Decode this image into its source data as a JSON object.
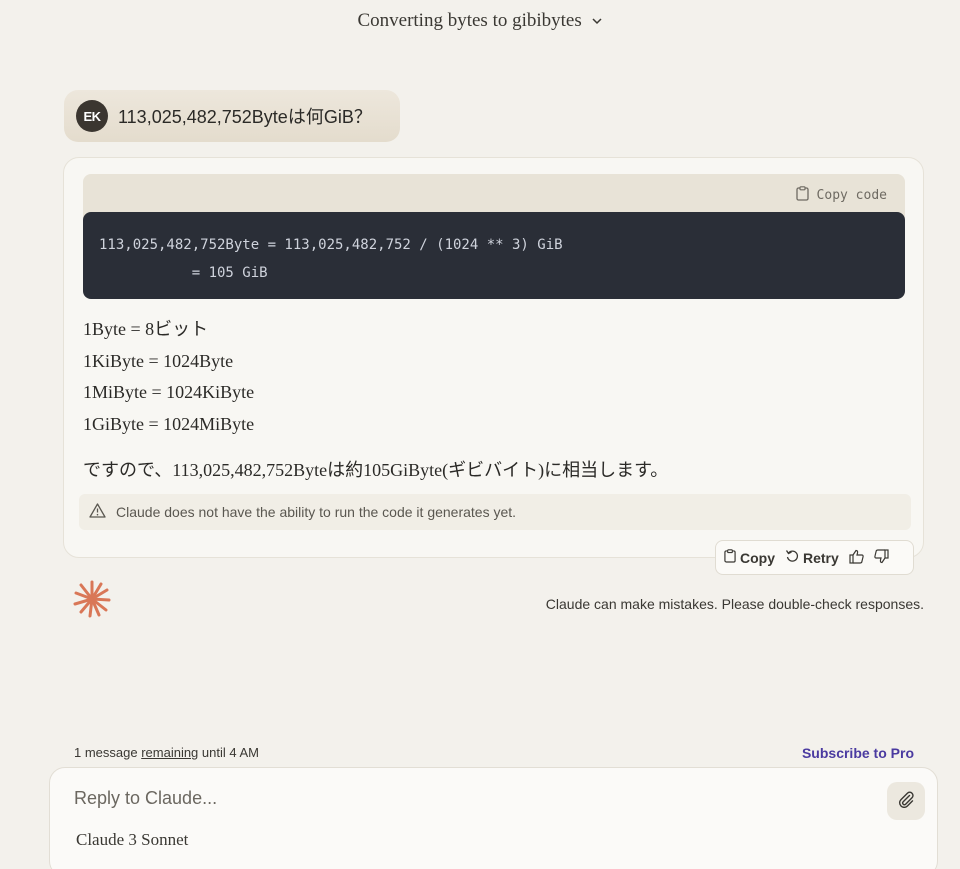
{
  "header": {
    "title": "Converting bytes to gibibytes",
    "chevron_icon": "chevron-down-icon"
  },
  "user_message": {
    "avatar_initials": "EK",
    "text": "113,025,482,752Byteは何GiB？"
  },
  "assistant": {
    "copy_code_label": "Copy code",
    "code_lines": [
      "113,025,482,752Byte = 113,025,482,752 / (1024 ** 3) GiB",
      "           = 105 GiB"
    ],
    "definitions": [
      "1Byte = 8ビット",
      "1KiByte = 1024Byte",
      "1MiByte = 1024KiByte",
      "1GiByte = 1024MiByte"
    ],
    "summary": "ですので、113,025,482,752Byteは約105GiByte(ギビバイト)に相当します。",
    "warning": "Claude does not have the ability to run the code it generates yet."
  },
  "actions": {
    "copy_label": "Copy",
    "retry_label": "Retry"
  },
  "disclaimer": "Claude can make mistakes. Please double-check responses.",
  "footer": {
    "remaining_prefix": "1 message ",
    "remaining_link": "remaining",
    "remaining_suffix": " until 4 AM",
    "subscribe": "Subscribe to Pro"
  },
  "composer": {
    "placeholder": "Reply to Claude...",
    "model": "Claude 3 Sonnet"
  },
  "colors": {
    "accent": "#d97757",
    "subscribe": "#4a3aa0",
    "code_bg": "#2a2e37"
  }
}
